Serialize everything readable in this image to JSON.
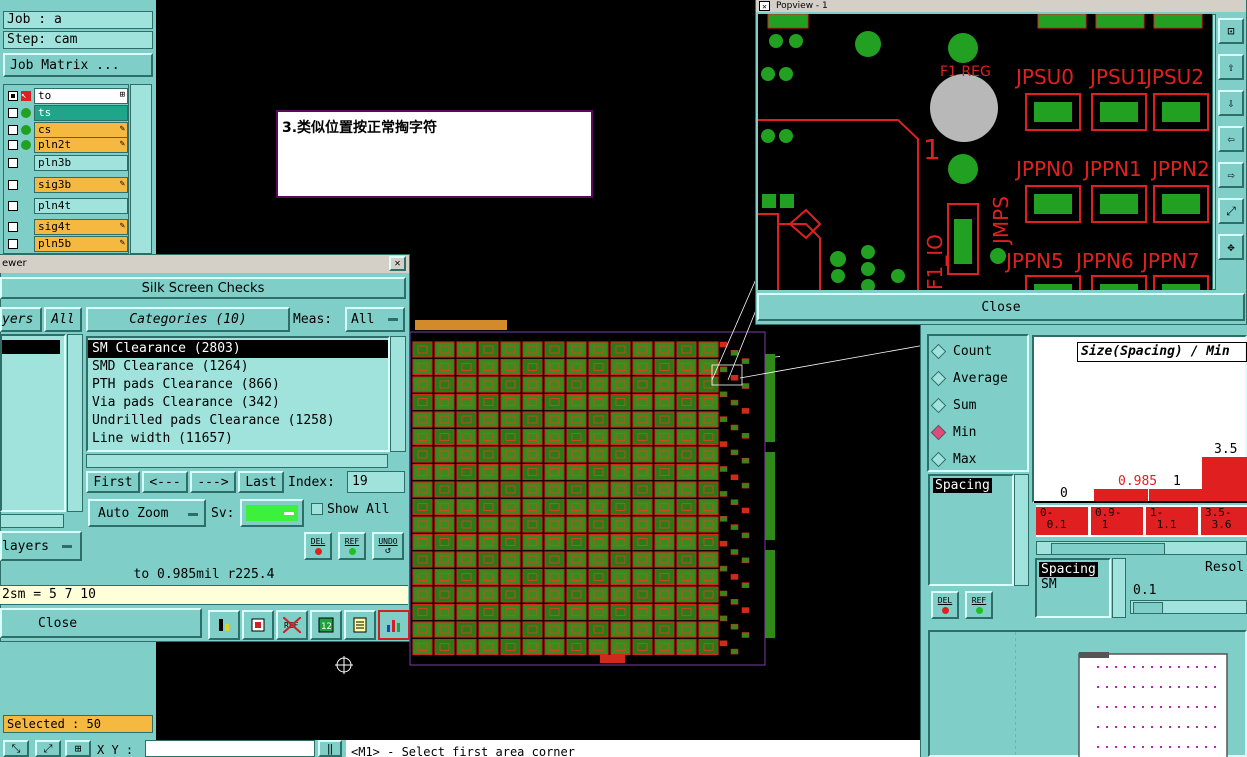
{
  "left_panel": {
    "job": "Job : a",
    "step": "Step: cam",
    "job_matrix": "Job Matrix ...",
    "layers": [
      {
        "name": "to",
        "style": "white",
        "checked": true,
        "icon": "arrow"
      },
      {
        "name": "ts",
        "style": "green",
        "checked": false,
        "icon": "circle"
      },
      {
        "name": "cs",
        "style": "orange",
        "checked": false,
        "icon": "circle"
      },
      {
        "name": "pln2t",
        "style": "orange",
        "checked": false,
        "icon": "circle"
      },
      {
        "name": "pln3b",
        "style": "tealbg",
        "checked": false,
        "icon": "none"
      },
      {
        "name": "sig3b",
        "style": "orange",
        "checked": false,
        "icon": "none"
      },
      {
        "name": "pln4t",
        "style": "tealbg",
        "checked": false,
        "icon": "none"
      },
      {
        "name": "sig4t",
        "style": "orange",
        "checked": false,
        "icon": "none"
      },
      {
        "name": "pln5b",
        "style": "orange",
        "checked": false,
        "icon": "none"
      }
    ],
    "selected": "Selected : 50"
  },
  "annotation": "3.类似位置按正常掏字符",
  "viewer": {
    "title": "ewer",
    "close_x": "✕",
    "heading": "Silk Screen Checks",
    "layers_label": "yers",
    "all_label": "All",
    "categories_label": "Categories (10)",
    "meas_label": "Meas:",
    "meas_value": "All",
    "categories": [
      "SM Clearance (2803)",
      "SMD Clearance (1264)",
      "PTH pads Clearance (866)",
      "Via pads Clearance (342)",
      "Undrilled pads Clearance (1258)",
      "Line width (11657)"
    ],
    "first": "First",
    "prev": "<---",
    "next": "--->",
    "last": "Last",
    "index_label": "Index:",
    "index_value": "19",
    "auto_zoom": "Auto Zoom",
    "sv_label": "Sv:",
    "show_all": "Show All",
    "layers_menu": "layers",
    "del": "DEL",
    "ref": "REF",
    "undo": "UNDO",
    "measure": "to 0.985mil  r225.4",
    "formula": "2sm = 5 7 10",
    "close": "Close"
  },
  "popview": {
    "title": "Popview - 1",
    "close": "Close",
    "labels": [
      "F1 REG",
      "JPSU0",
      "JPSU1",
      "JPSU2",
      "JPPN0",
      "JPPN1",
      "JPPN2",
      "JPPN5",
      "JPPN6",
      "JPPN7",
      "JMPS",
      "1",
      "F1_IO"
    ]
  },
  "stats": {
    "options": [
      {
        "label": "Count",
        "on": false
      },
      {
        "label": "Average",
        "on": false
      },
      {
        "label": "Sum",
        "on": false
      },
      {
        "label": "Min",
        "on": true
      },
      {
        "label": "Max",
        "on": false
      }
    ],
    "chart_title": "Size(Spacing) / Min",
    "bar_labels": [
      "0",
      "0.985",
      "1",
      "3.5"
    ],
    "bins": [
      "0-\n 0.1",
      "0.9-\n 1",
      "1-\n 1.1",
      "3.5-\n 3.6"
    ],
    "list_top": "Spacing",
    "list2_a": "Spacing",
    "list2_b": "SM",
    "resol_label": "Resol",
    "resol_value": "0.1",
    "del": "DEL",
    "ref": "REF"
  },
  "status": {
    "xy_label": "X Y :",
    "message": "<M1> - Select first area corner"
  }
}
